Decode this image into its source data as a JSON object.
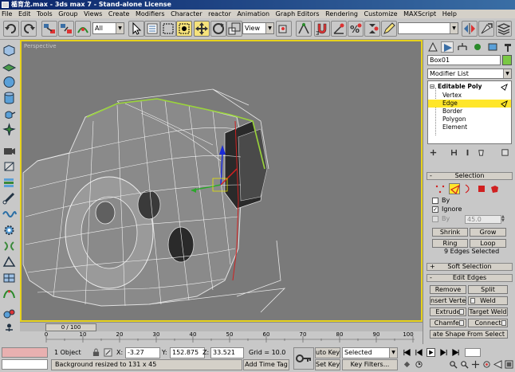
{
  "window": {
    "title": "楯育龙.max - 3ds max 7 - Stand-alone License"
  },
  "menu": [
    "File",
    "Edit",
    "Tools",
    "Group",
    "Views",
    "Create",
    "Modifiers",
    "Character",
    "reactor",
    "Animation",
    "Graph Editors",
    "Rendering",
    "Customize",
    "MAXScript",
    "Help"
  ],
  "toolbar": {
    "selection_filter": "All",
    "ref_coord": "View"
  },
  "viewport": {
    "label": "Perspective"
  },
  "timeline": {
    "slider": "0 / 100",
    "ticks": [
      "0",
      "10",
      "20",
      "30",
      "40",
      "50",
      "60",
      "70",
      "80",
      "90",
      "100"
    ]
  },
  "panel": {
    "object_name": "Box01",
    "modifier_list": "Modifier List",
    "stack": {
      "root": "Editable Poly",
      "items": [
        "Vertex",
        "Edge",
        "Border",
        "Polygon",
        "Element"
      ]
    },
    "selection": {
      "title": "Selection",
      "by_label": "By",
      "ignore_label": "Ignore",
      "by_angle_label": "By",
      "angle_value": "45.0",
      "shrink": "Shrink",
      "grow": "Grow",
      "ring": "Ring",
      "loop": "Loop",
      "status": "9 Edges Selected"
    },
    "soft_selection": {
      "title": "Soft Selection"
    },
    "edit_edges": {
      "title": "Edit Edges",
      "remove": "Remove",
      "split": "Split",
      "insert_vertex": "nsert Verte",
      "weld": "Weld",
      "extrude": "Extrude",
      "target_weld": "Target Weld",
      "chamfer": "Chamfer",
      "connect": "Connect",
      "create_shape": "ate Shape From Select"
    }
  },
  "status": {
    "objects": "1 Object",
    "x_label": "X:",
    "x": "-3.27",
    "y_label": "Y:",
    "y": "152.875",
    "z_label": "Z:",
    "z": "33.521",
    "grid": "Grid = 10.0",
    "auto_key": "uto Key",
    "set_key": "Set Key",
    "selected_dd": "Selected",
    "key_filters": "Key Filters...",
    "prompt": "Background resized to 131 x 45",
    "add_time_tag": "Add Time Tag"
  },
  "colors": {
    "accent": "#ffe62a",
    "title_bar": "#0a246a",
    "object_color": "#7ac843"
  }
}
